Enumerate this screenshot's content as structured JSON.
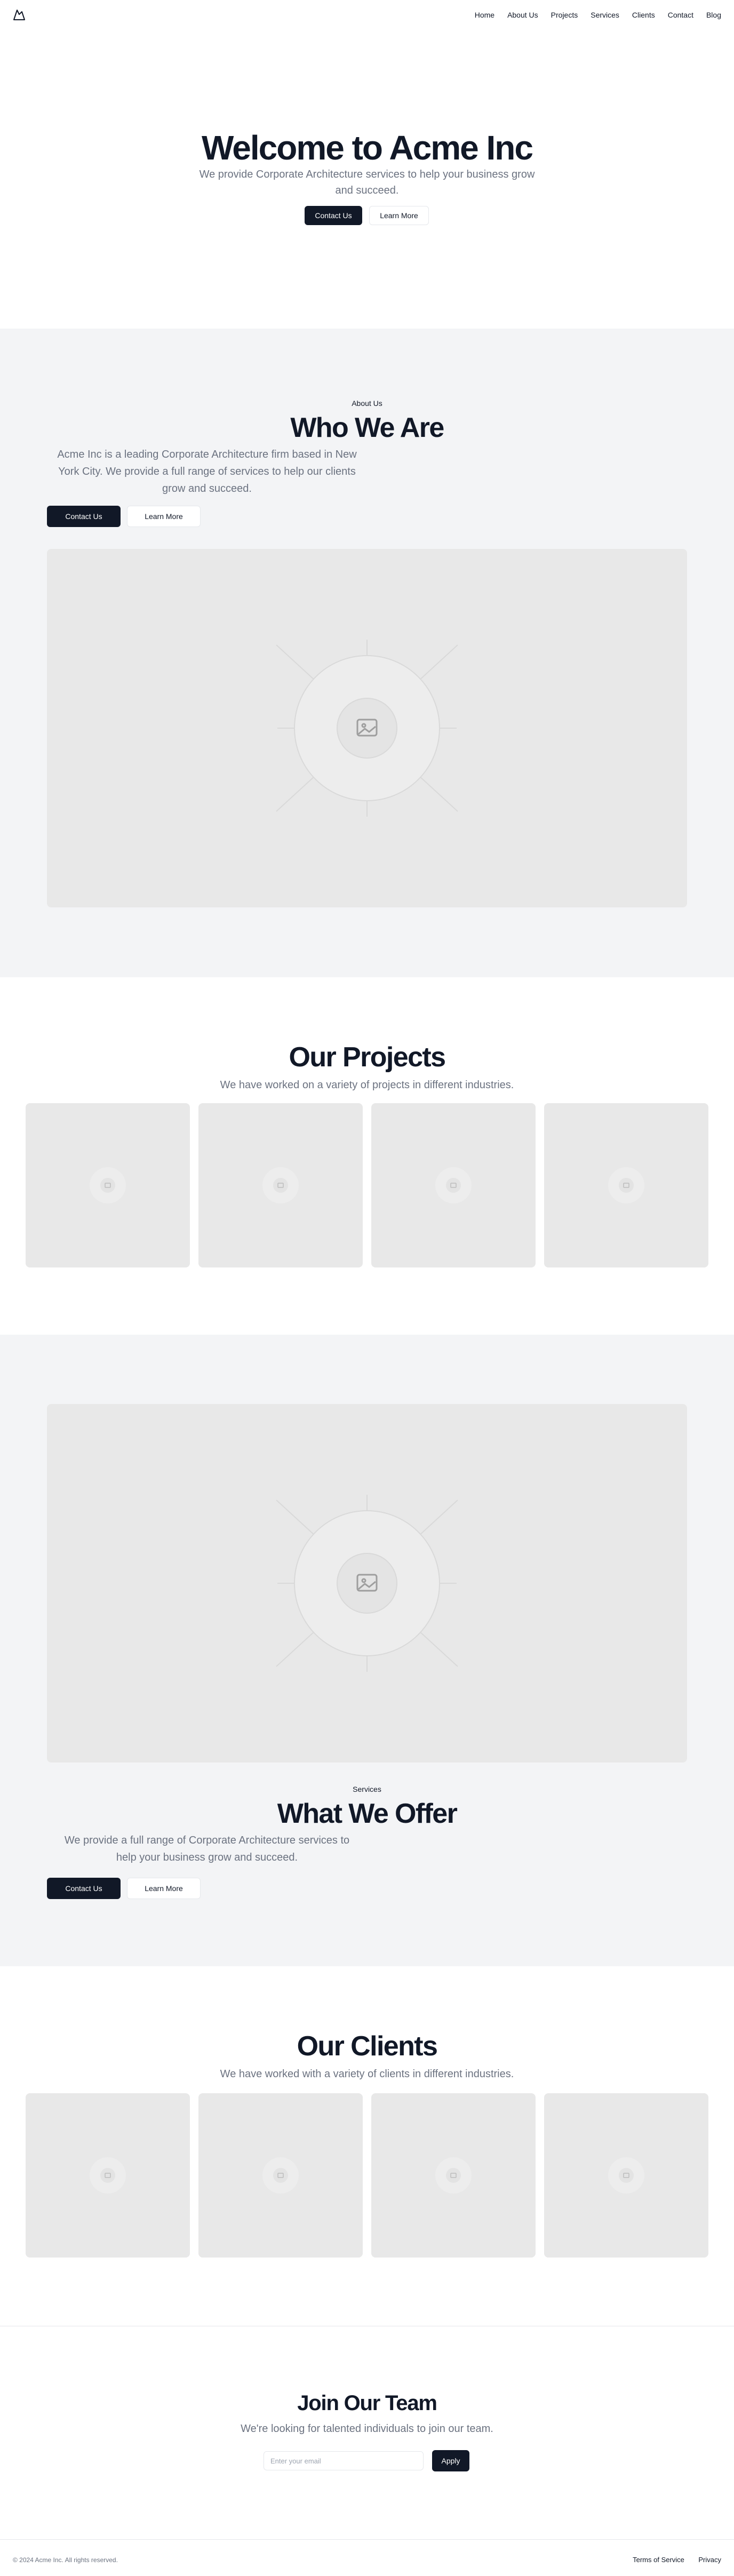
{
  "header": {
    "logo_icon": "mountain-logo-icon",
    "nav": [
      "Home",
      "About Us",
      "Projects",
      "Services",
      "Clients",
      "Contact",
      "Blog"
    ]
  },
  "hero": {
    "title": "Welcome to Acme Inc",
    "subtitle_line1": "We provide Corporate Architecture services to help your business grow",
    "subtitle_line2": "and succeed.",
    "primary_button": "Contact Us",
    "secondary_button": "Learn More"
  },
  "about": {
    "eyebrow": "About Us",
    "title": "Who We Are",
    "body_line1": "Acme Inc is a leading Corporate Architecture firm based in New",
    "body_line2": "York City. We provide a full range of services to help our clients",
    "body_line3": "grow and succeed.",
    "primary_button": "Contact Us",
    "secondary_button": "Learn More",
    "image_icon": "image-placeholder-icon"
  },
  "projects": {
    "title": "Our Projects",
    "subtitle": "We have worked on a variety of projects in different industries.",
    "card_icon": "image-placeholder-icon"
  },
  "services": {
    "eyebrow": "Services",
    "title": "What We Offer",
    "body_line1": "We provide a full range of Corporate Architecture services to",
    "body_line2": "help your business grow and succeed.",
    "primary_button": "Contact Us",
    "secondary_button": "Learn More",
    "image_icon": "image-placeholder-icon"
  },
  "clients": {
    "title": "Our Clients",
    "subtitle": "We have worked with a variety of clients in different industries.",
    "card_icon": "image-placeholder-icon"
  },
  "join": {
    "title": "Join Our Team",
    "subtitle": "We're looking for talented individuals to join our team.",
    "email_placeholder": "Enter your email",
    "apply_button": "Apply"
  },
  "footer": {
    "copyright": "© 2024 Acme Inc. All rights reserved.",
    "links": [
      "Terms of Service",
      "Privacy"
    ]
  },
  "colors": {
    "dark": "#111827",
    "muted": "#6b7280",
    "section_gray": "#f3f4f6",
    "placeholder": "#e8e8e8"
  }
}
